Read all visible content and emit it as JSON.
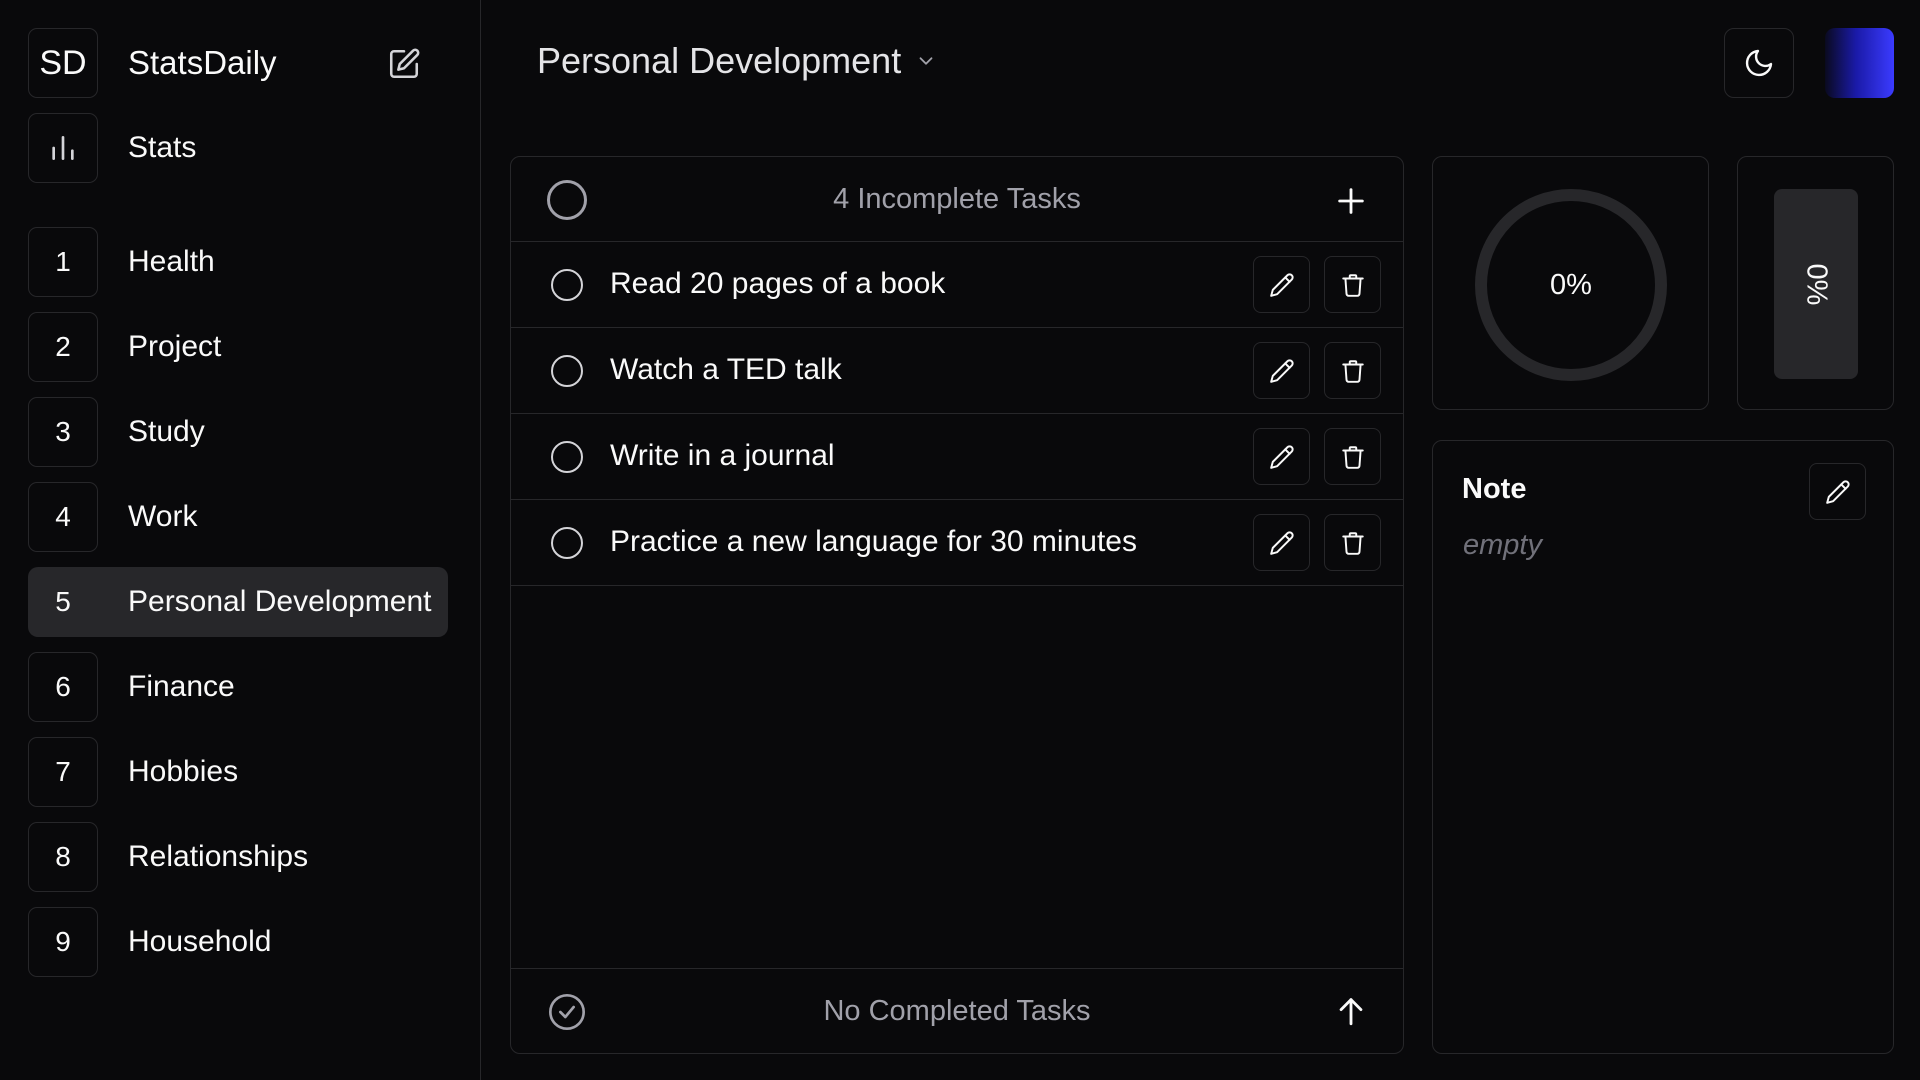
{
  "app": {
    "logo": "SD",
    "name": "StatsDaily"
  },
  "sidebar": {
    "stats_label": "Stats",
    "items": [
      {
        "num": "1",
        "label": "Health"
      },
      {
        "num": "2",
        "label": "Project"
      },
      {
        "num": "3",
        "label": "Study"
      },
      {
        "num": "4",
        "label": "Work"
      },
      {
        "num": "5",
        "label": "Personal Development",
        "active": true
      },
      {
        "num": "6",
        "label": "Finance"
      },
      {
        "num": "7",
        "label": "Hobbies"
      },
      {
        "num": "8",
        "label": "Relationships"
      },
      {
        "num": "9",
        "label": "Household"
      }
    ]
  },
  "header": {
    "title": "Personal Development"
  },
  "tasks": {
    "incomplete_label": "4 Incomplete Tasks",
    "items": [
      {
        "text": "Read 20 pages of a book"
      },
      {
        "text": "Watch a TED talk"
      },
      {
        "text": "Write in a journal"
      },
      {
        "text": "Practice a new language for 30 minutes"
      }
    ],
    "completed_label": "No Completed Tasks"
  },
  "progress": {
    "ring_label": "0%",
    "ring_fraction": 0,
    "bar_label": "0%",
    "bar_fraction": 0
  },
  "note": {
    "title": "Note",
    "body": "empty"
  },
  "colors": {
    "background": "#09090b",
    "border": "#27272a",
    "muted_text": "#a1a1aa",
    "avatar_gradient_end": "#3b3bff"
  },
  "icons": {
    "compose": "pencil-square-icon",
    "stats": "bar-chart-icon",
    "chevron": "chevron-down-icon",
    "theme": "moon-icon",
    "add": "plus-icon",
    "edit": "pencil-icon",
    "delete": "trash-icon",
    "completed": "check-circle-icon",
    "expand": "arrow-up-icon"
  }
}
